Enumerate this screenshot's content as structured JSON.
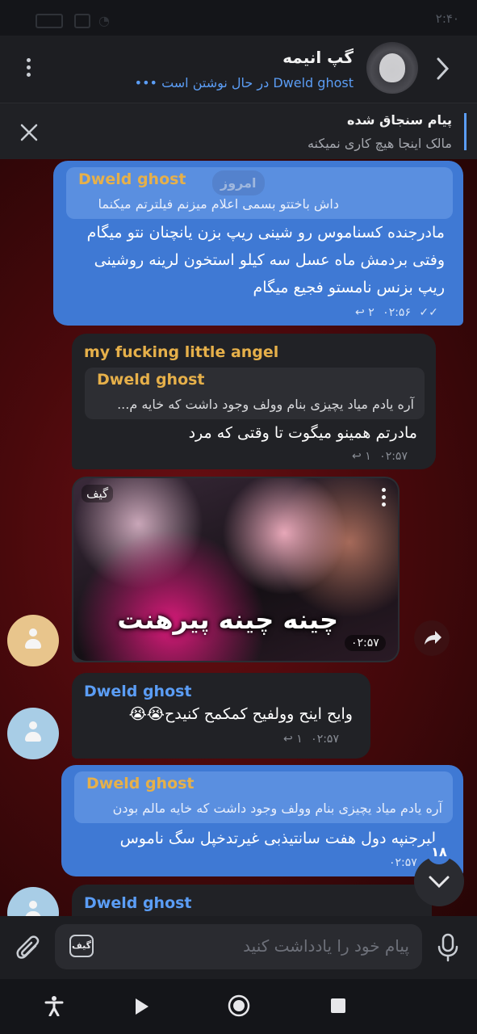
{
  "status_bar": {
    "time": "۲:۴۰"
  },
  "header": {
    "title": "گپ انیمه",
    "typing_user": "Dweld ghost",
    "typing_text": "در حال نوشتن است",
    "typing_dots": "•••"
  },
  "pinned": {
    "title": "پیام سنجاق شده",
    "text": "مالک اینجا هیچ کاری نمیکنه"
  },
  "date_chip": "امروز",
  "messages": [
    {
      "reply_name": "Dweld ghost",
      "reply_text": "داش باختتو بسمی اعلام میزنم فیلترتم میکنما",
      "lines": [
        "مادرجنده کسناموس رو شینی ریپ بزن یانچنان نتو میگام",
        "وفتی بردمش ماه عسل سه کیلو استخون لرینه روشینی",
        "ریپ بزنس نامستو فجیع میگام"
      ],
      "time": "۰۲:۵۶",
      "replies": "۲"
    },
    {
      "sender": "my fucking little angel",
      "reply_name": "Dweld ghost",
      "reply_text": "آره یادم میاد یچیزی بنام وولف وجود داشت که خایه م...",
      "text": "مادرتم همینو میگوت تا وقتی که مرد",
      "time": "۰۲:۵۷",
      "replies": "۱"
    },
    {
      "gif_label": "گیف",
      "caption": "چینه چینه پیرهنت",
      "time": "۰۲:۵۷"
    },
    {
      "sender": "Dweld ghost",
      "text": "وایح اینح وولفیح کمکمح کنیدح",
      "emoji": "😭😭",
      "time": "۰۲:۵۷",
      "replies": "۱"
    },
    {
      "reply_name": "Dweld ghost",
      "reply_text": "آره یادم میاد یچیزی بنام وولف وجود داشت که خایه مالم بودن",
      "text": "لیرجنپه دول هفت سانتیذبی غیرتدخپل سگ ناموس",
      "time": "۰۲:۵۷"
    },
    {
      "sender": "Dweld ghost"
    }
  ],
  "unread_count": "۱۸",
  "composer": {
    "placeholder": "پیام خود را یادداشت کنید",
    "gif_label": "گیف"
  },
  "colors": {
    "accent": "#3f79d4",
    "link": "#5b9df5",
    "sender_gold": "#e6b04a",
    "chat_background": "#5a0a0e"
  }
}
